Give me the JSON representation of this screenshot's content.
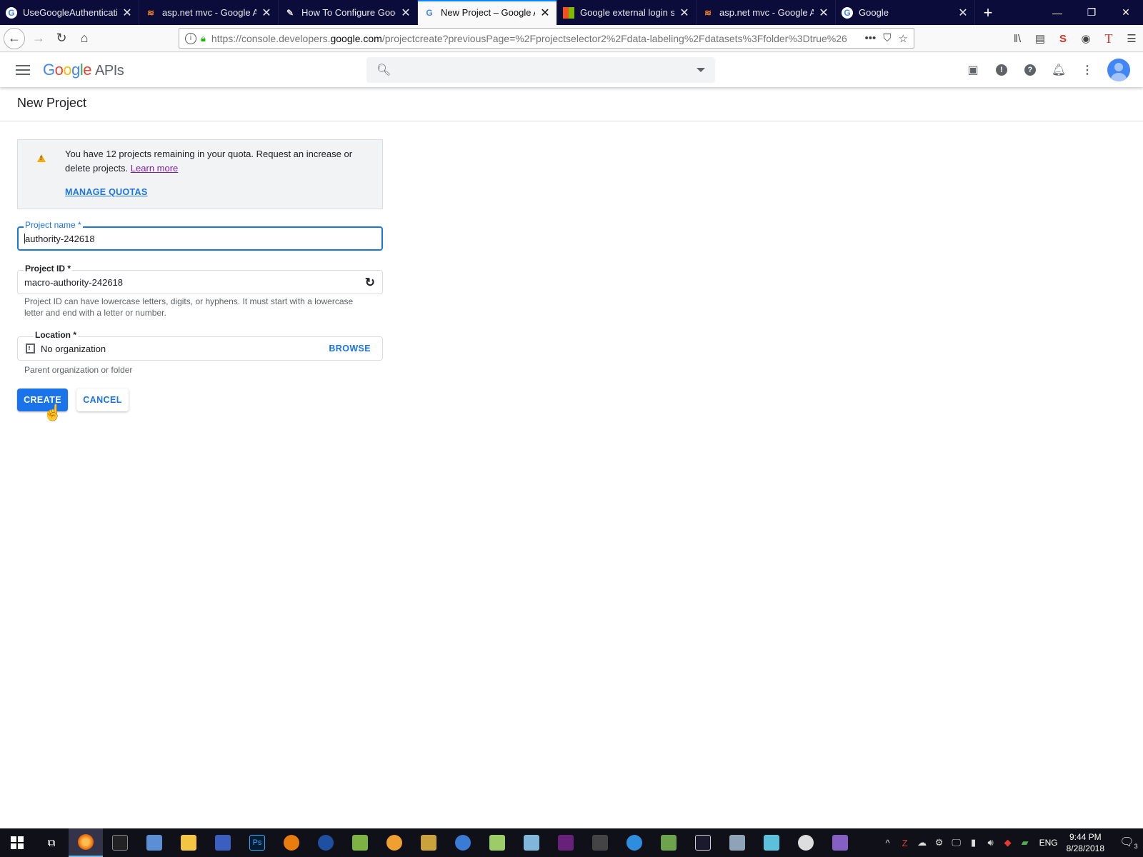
{
  "browser": {
    "tabs": [
      {
        "title": "UseGoogleAuthentication",
        "favicon": "google-g-icon",
        "active": false
      },
      {
        "title": "asp.net mvc - Google Aut",
        "favicon": "stackoverflow-icon",
        "active": false
      },
      {
        "title": "How To Configure Google",
        "favicon": "puzzle-icon",
        "active": false
      },
      {
        "title": "New Project – Google API",
        "favicon": "google-g-icon",
        "active": true
      },
      {
        "title": "Google external login setu",
        "favicon": "microsoft-icon",
        "active": false
      },
      {
        "title": "asp.net mvc - Google Aut",
        "favicon": "stackoverflow-icon",
        "active": false
      },
      {
        "title": "Google",
        "favicon": "google-g-icon",
        "active": false
      }
    ],
    "url_prefix": "https://console.developers.",
    "url_domain": "google.com",
    "url_suffix": "/projectcreate?previousPage=%2Fprojectselector2%2Fdata-labeling%2Fdatasets%3Ffolder%3Dtrue%26"
  },
  "header": {
    "logo_google": [
      "G",
      "o",
      "o",
      "g",
      "l",
      "e"
    ],
    "logo_apis": "APIs",
    "search_placeholder": ""
  },
  "page": {
    "title": "New Project",
    "quota_message": "You have 12 projects remaining in your quota. Request an increase or delete projects.",
    "learn_more": "Learn more",
    "manage_quotas": "MANAGE QUOTAS",
    "project_name_label": "Project name *",
    "project_name_value": "authority-242618",
    "project_id_label": "Project ID *",
    "project_id_value": "macro-authority-242618",
    "project_id_help": "Project ID can have lowercase letters, digits, or hyphens. It must start with a lowercase letter and end with a letter or number.",
    "location_label": "Location *",
    "location_value": "No organization",
    "browse_label": "BROWSE",
    "location_help": "Parent organization or folder",
    "create_label": "CREATE",
    "cancel_label": "CANCEL"
  },
  "taskbar": {
    "language": "ENG",
    "time": "9:44 PM",
    "date": "8/28/2018",
    "notification_count": "3"
  },
  "colors": {
    "accent": "#1a73e8",
    "tabstrip": "#0c0c3a",
    "warning": "#f9ab00"
  }
}
